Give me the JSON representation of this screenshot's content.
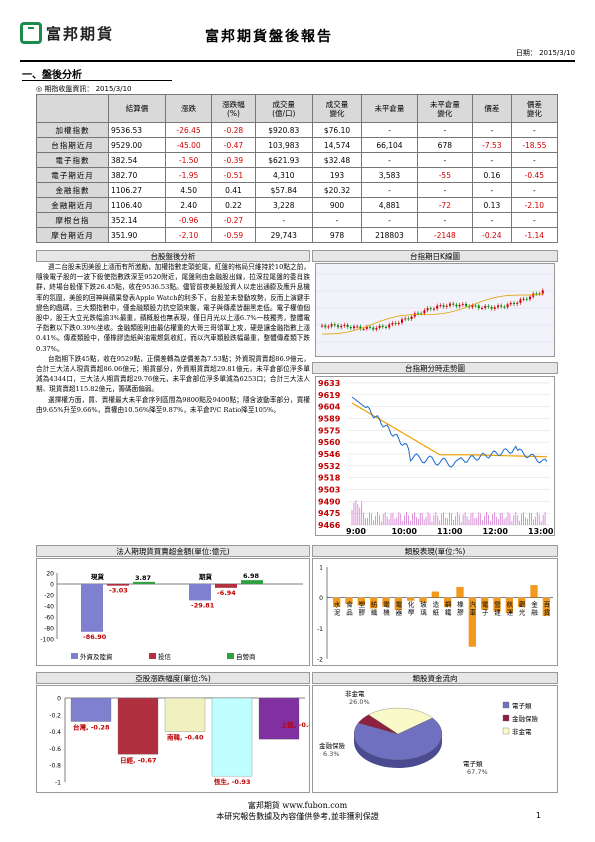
{
  "header": {
    "brand": "富邦期貨",
    "title": "富邦期貨盤後報告",
    "date_label": "日期：",
    "date_value": "2015/3/10"
  },
  "section": {
    "title": "一、盤後分析",
    "info_label": "◎ 期指收盤資訊：",
    "info_date": "2015/3/10"
  },
  "market_table": {
    "headers": [
      "",
      "結算價",
      "漲跌",
      "漲跌幅\n(%)",
      "成交量\n(億/口)",
      "成交量\n變化",
      "未平倉量",
      "未平倉量\n變化",
      "價差",
      "價差\n變化"
    ],
    "rows": [
      [
        "加權指數",
        "9536.53",
        "-26.45",
        "-0.28",
        "$920.83",
        "$76.10",
        "-",
        "-",
        "-",
        "-"
      ],
      [
        "台指期近月",
        "9529.00",
        "-45.00",
        "-0.47",
        "103,983",
        "14,574",
        "66,104",
        "678",
        "-7.53",
        "-18.55"
      ],
      [
        "電子指數",
        "382.54",
        "-1.50",
        "-0.39",
        "$621.93",
        "$32.48",
        "-",
        "-",
        "-",
        "-"
      ],
      [
        "電子期近月",
        "382.70",
        "-1.95",
        "-0.51",
        "4,310",
        "193",
        "3,583",
        "-55",
        "0.16",
        "-0.45"
      ],
      [
        "金融指數",
        "1106.27",
        "4.50",
        "0.41",
        "$57.84",
        "$20.32",
        "-",
        "-",
        "-",
        "-"
      ],
      [
        "金融期近月",
        "1106.40",
        "2.40",
        "0.22",
        "3,228",
        "900",
        "4,881",
        "-72",
        "0.13",
        "-2.10"
      ],
      [
        "摩根台指",
        "352.14",
        "-0.96",
        "-0.27",
        "-",
        "-",
        "-",
        "-",
        "-",
        "-"
      ],
      [
        "摩台期近月",
        "351.90",
        "-2.10",
        "-0.59",
        "29,743",
        "978",
        "218803",
        "-2148",
        "-0.24",
        "-1.14"
      ]
    ]
  },
  "analysis": {
    "heading": "台股盤後分析",
    "paragraphs": [
      "週二台股未因美股上漲而有所激勵，加權指數走頭蛇尾，紅盤的格局只維持於10點之前，隨後電子股的一波下殺使指數跌深至9520附近，尾盤則由金融股出線，拉深拉尾盤的委肖族群，終場台股僅下跌26.45點，收在9536.53點。儘管前夜美股設資人以走出通膨及應升息機率的氛圍，美股的回神與蘋果發表Apple Watch的利多下，台股並未發動攻勢，反而上演鍵手變色的戲碼，三大類指數中，僅金融類股力抗空頭來襲，電子與傳產皆翻黑走低。電子權值個股中，股王大立光跌幅逾3%最重，蘋概股也無表現，僅日月光以上漲6.7%一枝獨秀，整體電子指數以下跌0.39%坐收。金融類股則由最佔權重的大哥三哥領軍上攻，硬是讓金融指數上漲0.41%。傳產類股中，僅橡膠造紙與油電燃氣收紅，而以汽車類股跌幅最重，整體傳產類下跌0.37%。",
      "台指期下跌45點，收在9529點，正價差轉為逆價差為7.53點；外資現貨賣超86.9億元，合計三大法人現貨賣超86.06億元；期貨部分，外資期貨賣超29.81億元，未平倉部位淨多單減為4344口，三大法人期貨賣超29.76億元，未平倉部位淨多單減為6253口；合計三大法人期、現貨賣超115.82億元，籌碼面偏弱。",
      "選擇權方面，買、賣權最大未平倉序列區間為9800點及9400點；隱含波動率部分，買權由9.65%升至9.66%，賣權由10.56%降至9.87%，未平倉P/C Ratio降至105%。"
    ]
  },
  "kline": {
    "heading": "台指期日K線圖"
  },
  "intraday": {
    "heading": "台指期分時走勢圖",
    "y_ticks": [
      "9633",
      "9619",
      "9604",
      "9589",
      "9575",
      "9560",
      "9546",
      "9532",
      "9518",
      "9503",
      "9490",
      "9475",
      "9466"
    ],
    "x_ticks": [
      "9:00",
      "10:00",
      "11:00",
      "12:00",
      "13:00"
    ]
  },
  "institutional": {
    "heading": "法人期現貨買賣超金額(單位:億元)",
    "group_labels": [
      "現貨",
      "期貨"
    ],
    "y_ticks": [
      "20",
      "0",
      "-20",
      "-40",
      "-60",
      "-80",
      "-100"
    ],
    "legend": [
      "外資及陸資",
      "投信",
      "自營商"
    ],
    "colors": [
      "#8080d0",
      "#b03040",
      "#30a040"
    ]
  },
  "sector_perf": {
    "heading": "類股表現(單位:%)",
    "y_ticks": [
      "1",
      "0",
      "-1",
      "-2"
    ],
    "categories": [
      "水泥",
      "食品",
      "塑膠",
      "紡織",
      "電機",
      "電器",
      "化學",
      "玻璃",
      "造紙",
      "鋼鐵",
      "橡膠",
      "汽車",
      "電子",
      "營建",
      "航運",
      "觀光",
      "金融",
      "百貨"
    ]
  },
  "index_change": {
    "heading": "亞股漲跌幅度(單位:%)",
    "y_ticks": [
      "0",
      "-0.2",
      "-0.4",
      "-0.6",
      "-0.8",
      "-1"
    ],
    "labels": [
      "台灣, -0.28",
      "日經, -0.67",
      "南韓, -0.40",
      "恆生, -0.93",
      "上証, -0.49"
    ]
  },
  "fund_flow": {
    "heading": "類股資金流向",
    "slices": [
      {
        "label": "非金電",
        "pct": "26.0%"
      },
      {
        "label": "金融保險",
        "pct": "6.3%"
      },
      {
        "label": "電子類",
        "pct": "67.7%"
      }
    ],
    "legend": [
      "電子類",
      "金融保險",
      "非金電"
    ]
  },
  "chart_data": [
    {
      "type": "bar",
      "title": "法人期現貨買賣超金額(單位:億元)",
      "categories": [
        "現貨",
        "期貨"
      ],
      "series": [
        {
          "name": "外資及陸資",
          "values": [
            -86.9,
            -29.81
          ]
        },
        {
          "name": "投信",
          "values": [
            -3.03,
            -6.94
          ]
        },
        {
          "name": "自營商",
          "values": [
            3.87,
            6.98
          ]
        }
      ],
      "ylim": [
        -100,
        20
      ]
    },
    {
      "type": "bar",
      "title": "類股表現(單位:%)",
      "categories": [
        "水泥",
        "食品",
        "塑膠",
        "紡織",
        "電機",
        "電器",
        "化學",
        "玻璃",
        "造紙",
        "鋼鐵",
        "橡膠",
        "汽車",
        "電子",
        "營建",
        "航運",
        "觀光",
        "金融",
        "百貨"
      ],
      "values": [
        -0.3,
        -0.2,
        -0.25,
        -0.35,
        -0.3,
        -0.4,
        -0.1,
        -0.15,
        0.2,
        -0.3,
        0.35,
        -1.6,
        -0.39,
        -0.45,
        -0.5,
        -0.3,
        0.41,
        -0.6
      ],
      "ylim": [
        -2,
        1
      ]
    },
    {
      "type": "bar",
      "title": "亞股漲跌幅度(單位:%)",
      "categories": [
        "台灣",
        "日經",
        "南韓",
        "恆生",
        "上証"
      ],
      "values": [
        -0.28,
        -0.67,
        -0.4,
        -0.93,
        -0.49
      ],
      "ylim": [
        -1,
        0
      ]
    },
    {
      "type": "pie",
      "title": "類股資金流向",
      "categories": [
        "電子類",
        "金融保險",
        "非金電"
      ],
      "values": [
        67.7,
        6.3,
        26.0
      ]
    }
  ],
  "footer": {
    "line1": "富邦期貨 www.fubon.com",
    "line2": "本研究報告數據及內容僅供參考,並非獲利保證",
    "page": "1"
  }
}
